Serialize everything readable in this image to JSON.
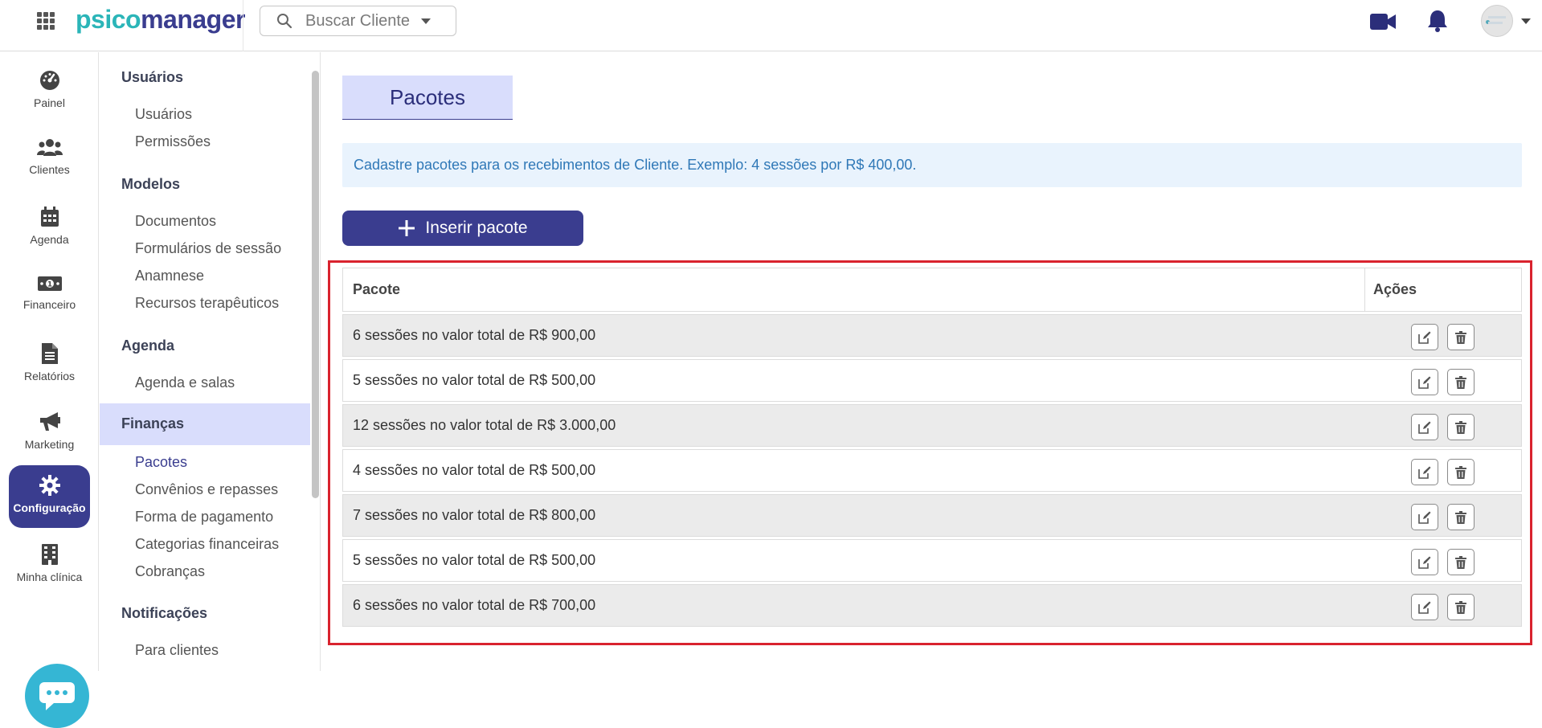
{
  "header": {
    "logo_part1": "psico",
    "logo_part2": "manager",
    "search_placeholder": "Buscar Cliente"
  },
  "leftnav": {
    "items": [
      {
        "label": "Painel",
        "icon": "dashboard-icon"
      },
      {
        "label": "Clientes",
        "icon": "users-icon"
      },
      {
        "label": "Agenda",
        "icon": "calendar-icon"
      },
      {
        "label": "Financeiro",
        "icon": "money-icon"
      },
      {
        "label": "Relatórios",
        "icon": "file-icon"
      },
      {
        "label": "Marketing",
        "icon": "megaphone-icon"
      },
      {
        "label": "Configuração",
        "icon": "gear-icon",
        "active": true
      },
      {
        "label": "Minha clínica",
        "icon": "building-icon"
      }
    ]
  },
  "sidebar": {
    "sections": [
      {
        "title": "Usuários",
        "links": [
          "Usuários",
          "Permissões"
        ]
      },
      {
        "title": "Modelos",
        "links": [
          "Documentos",
          "Formulários de sessão",
          "Anamnese",
          "Recursos terapêuticos"
        ]
      },
      {
        "title": "Agenda",
        "links": [
          "Agenda e salas"
        ]
      },
      {
        "title": "Finanças",
        "links": [
          "Pacotes",
          "Convênios e repasses",
          "Forma de pagamento",
          "Categorias financeiras",
          "Cobranças"
        ]
      },
      {
        "title": "Notificações",
        "links": [
          "Para clientes"
        ]
      }
    ]
  },
  "main": {
    "title": "Pacotes",
    "info": "Cadastre pacotes para os recebimentos de Cliente. Exemplo: 4 sessões por R$ 400,00.",
    "insert_button": "Inserir pacote",
    "table": {
      "col_package": "Pacote",
      "col_actions": "Ações",
      "rows": [
        "6 sessões no valor total de R$ 900,00",
        "5 sessões no valor total de R$ 500,00",
        "12 sessões no valor total de R$ 3.000,00",
        "4 sessões no valor total de R$ 500,00",
        "7 sessões no valor total de R$ 800,00",
        "5 sessões no valor total de R$ 500,00",
        "6 sessões no valor total de R$ 700,00"
      ]
    }
  },
  "colors": {
    "primary": "#3a3d8f",
    "accent": "#2bb5b8",
    "highlight": "#d9ddfc",
    "info_bg": "#e9f3fd",
    "annotation": "#d9232e"
  }
}
